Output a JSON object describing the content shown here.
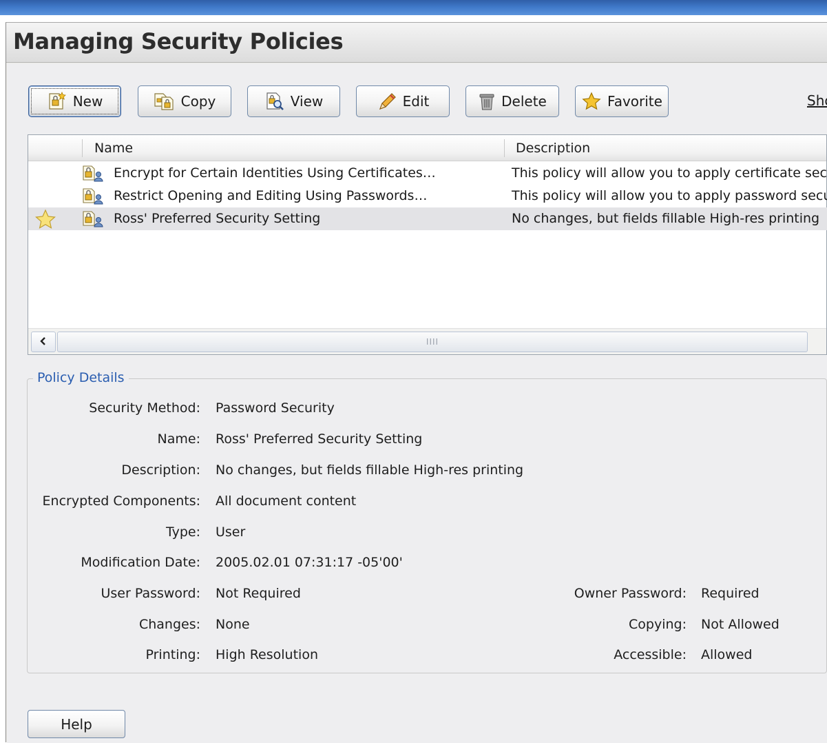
{
  "dialog": {
    "title": "Managing Security Policies"
  },
  "toolbar": {
    "new_label": "New",
    "copy_label": "Copy",
    "view_label": "View",
    "edit_label": "Edit",
    "delete_label": "Delete",
    "favorite_label": "Favorite",
    "show_label": "Sho"
  },
  "list": {
    "columns": [
      "Name",
      "Description"
    ],
    "rows": [
      {
        "name": "Encrypt for Certain Identities Using Certificates…",
        "description": "This policy will allow you to apply certificate secur",
        "favorite": false,
        "selected": false
      },
      {
        "name": "Restrict Opening and Editing Using Passwords…",
        "description": "This policy will allow you to apply password securi",
        "favorite": false,
        "selected": false
      },
      {
        "name": "Ross' Preferred Security Setting",
        "description": "No changes, but fields fillable High-res printing",
        "favorite": true,
        "selected": true
      }
    ],
    "scroll_grip": "IIII"
  },
  "details": {
    "legend": "Policy Details",
    "security_method": {
      "label": "Security Method:",
      "value": "Password Security"
    },
    "name": {
      "label": "Name:",
      "value": "Ross' Preferred Security Setting"
    },
    "description": {
      "label": "Description:",
      "value": "No changes, but fields fillable High-res printing"
    },
    "encrypted_components": {
      "label": "Encrypted Components:",
      "value": "All document content"
    },
    "type": {
      "label": "Type:",
      "value": "User"
    },
    "modification_date": {
      "label": "Modification Date:",
      "value": "2005.02.01 07:31:17 -05'00'"
    },
    "user_password": {
      "label": "User Password:",
      "value": "Not Required"
    },
    "changes": {
      "label": "Changes:",
      "value": "None"
    },
    "printing": {
      "label": "Printing:",
      "value": "High Resolution"
    },
    "owner_password": {
      "label": "Owner Password:",
      "value": "Required"
    },
    "copying": {
      "label": "Copying:",
      "value": "Not Allowed"
    },
    "accessible": {
      "label": "Accessible:",
      "value": "Allowed"
    }
  },
  "footer": {
    "help_label": "Help"
  },
  "colors": {
    "titlebar": "#3f78c8",
    "legend": "#2a5db0",
    "selected_row": "#e3e3e6",
    "star": "#f2c22c"
  }
}
